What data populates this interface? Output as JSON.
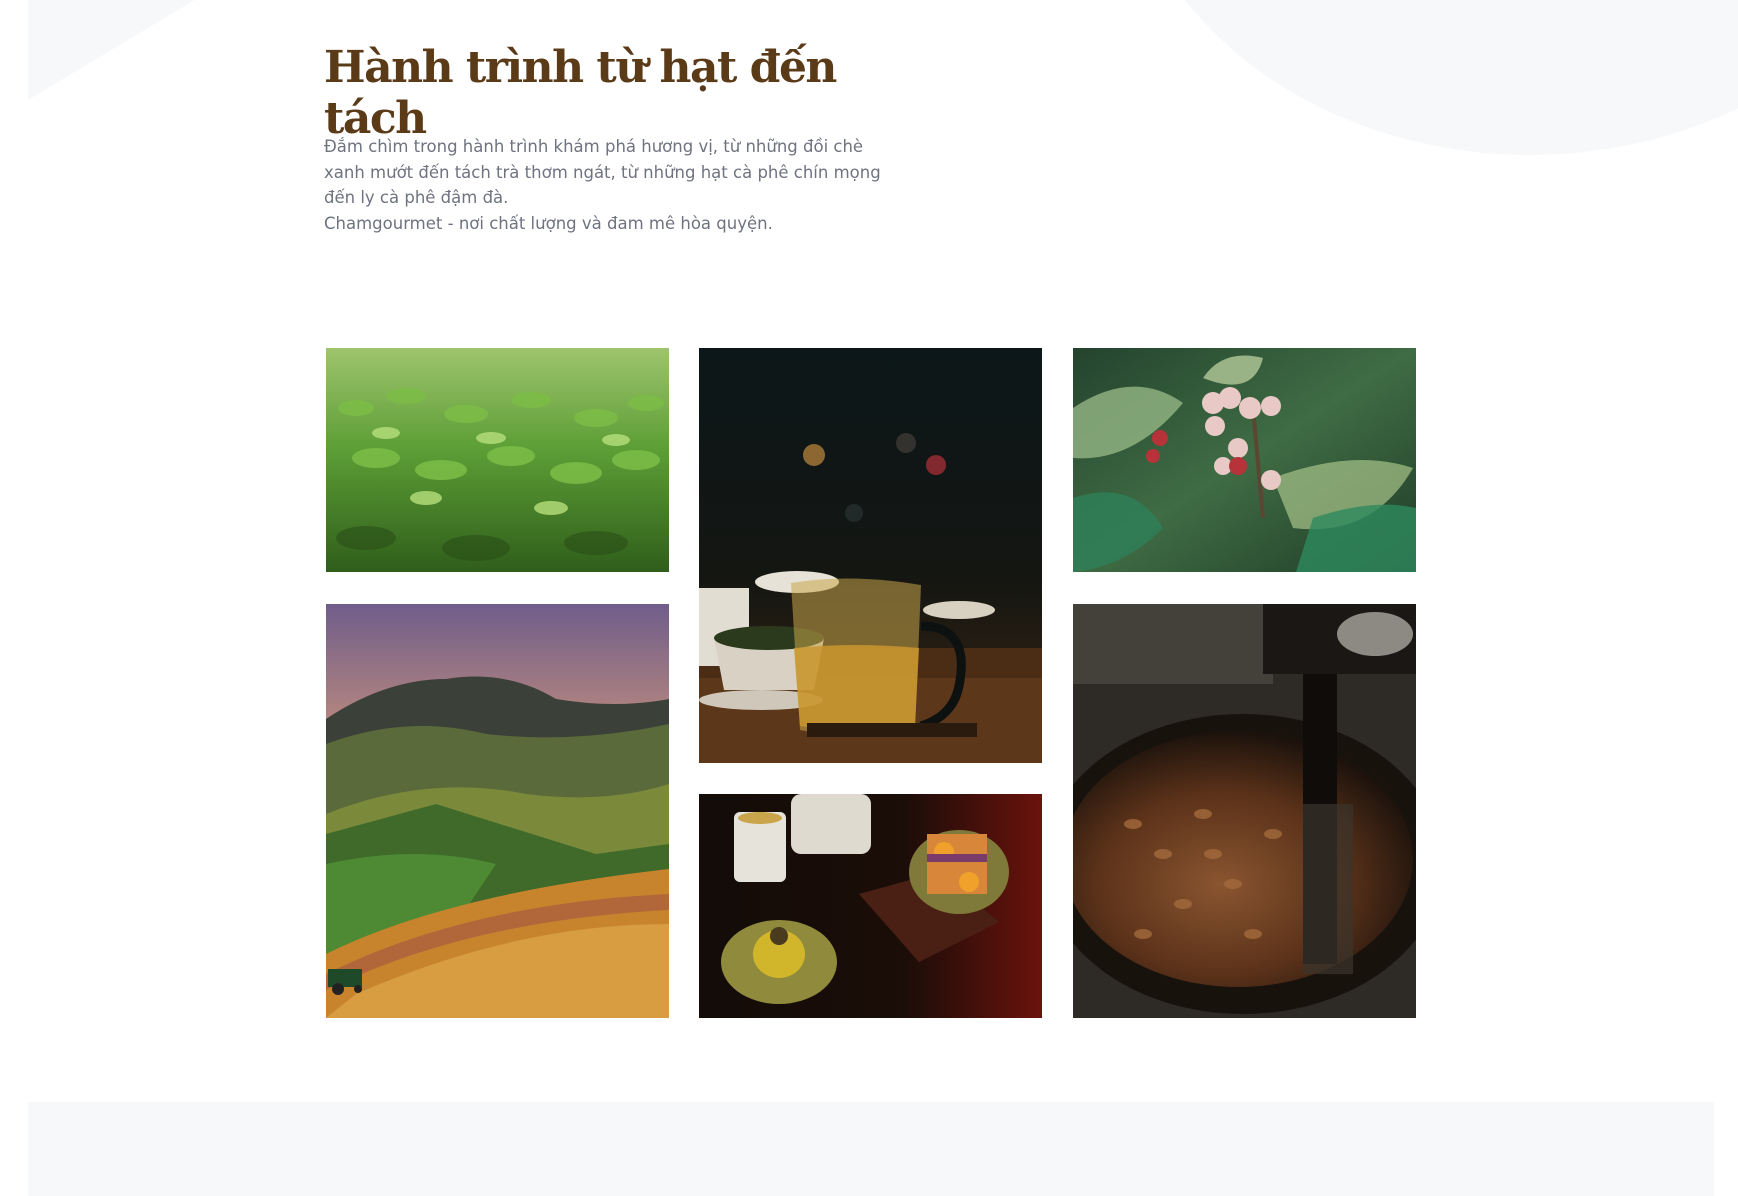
{
  "section": {
    "title": "Hành trình từ hạt đến tách",
    "intro_lines": [
      "Đắm chìm trong hành trình khám phá hương vị, từ những đồi chè",
      "xanh mướt đến tách trà thơm ngát, từ những hạt cà phê chín mọng",
      "đến ly cà phê đậm đà.",
      "Chamgourmet - nơi chất lượng và đam mê hòa quyện."
    ]
  },
  "gallery": {
    "images": [
      {
        "icon": "tea-field-photo"
      },
      {
        "icon": "tea-pitcher-photo"
      },
      {
        "icon": "coffee-cherries-photo"
      },
      {
        "icon": "hillside-plantation-photo"
      },
      {
        "icon": "mooncake-tea-photo"
      },
      {
        "icon": "coffee-roaster-photo"
      }
    ]
  },
  "colors": {
    "title": "#5a3a17",
    "body_text": "#6f7380",
    "soft_background": "#f7f8fa"
  }
}
